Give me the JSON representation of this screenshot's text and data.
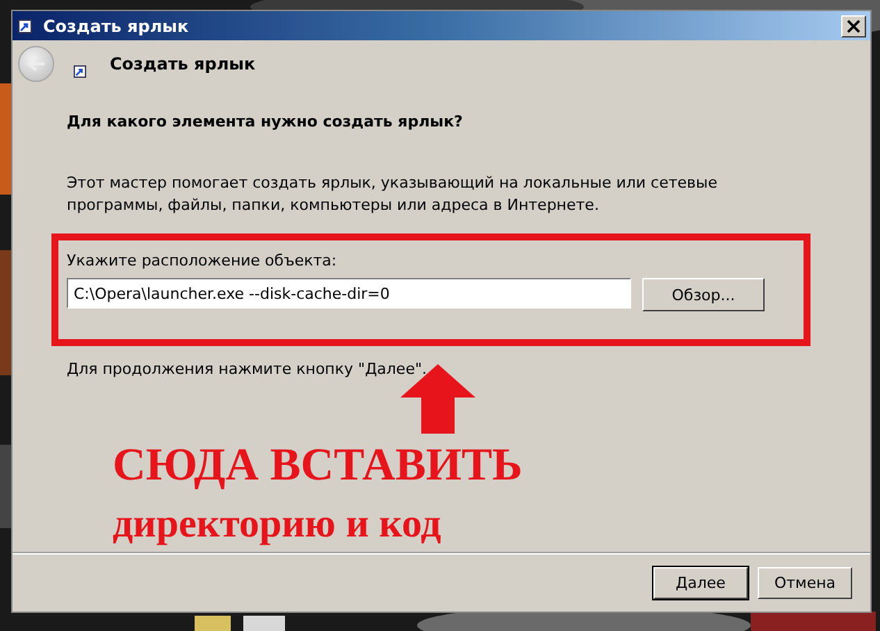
{
  "window": {
    "title": "Создать ярлык"
  },
  "header": {
    "title": "Создать ярлык"
  },
  "question": "Для какого элемента нужно создать ярлык?",
  "description": "Этот мастер помогает создать ярлык, указывающий на локальные или сетевые программы, файлы, папки, компьютеры или адреса в Интернете.",
  "location": {
    "label": "Укажите расположение объекта:",
    "value": "C:\\Opera\\launcher.exe --disk-cache-dir=0",
    "browse_button": "Обзор..."
  },
  "hint": "Для продолжения нажмите кнопку \"Далее\".",
  "annotation": {
    "lines": [
      "СЮДА ВСТАВИТЬ",
      "директорию и код"
    ]
  },
  "buttons": [
    {
      "label": "Далее",
      "default": true
    },
    {
      "label": "Отмена",
      "default": false
    }
  ]
}
